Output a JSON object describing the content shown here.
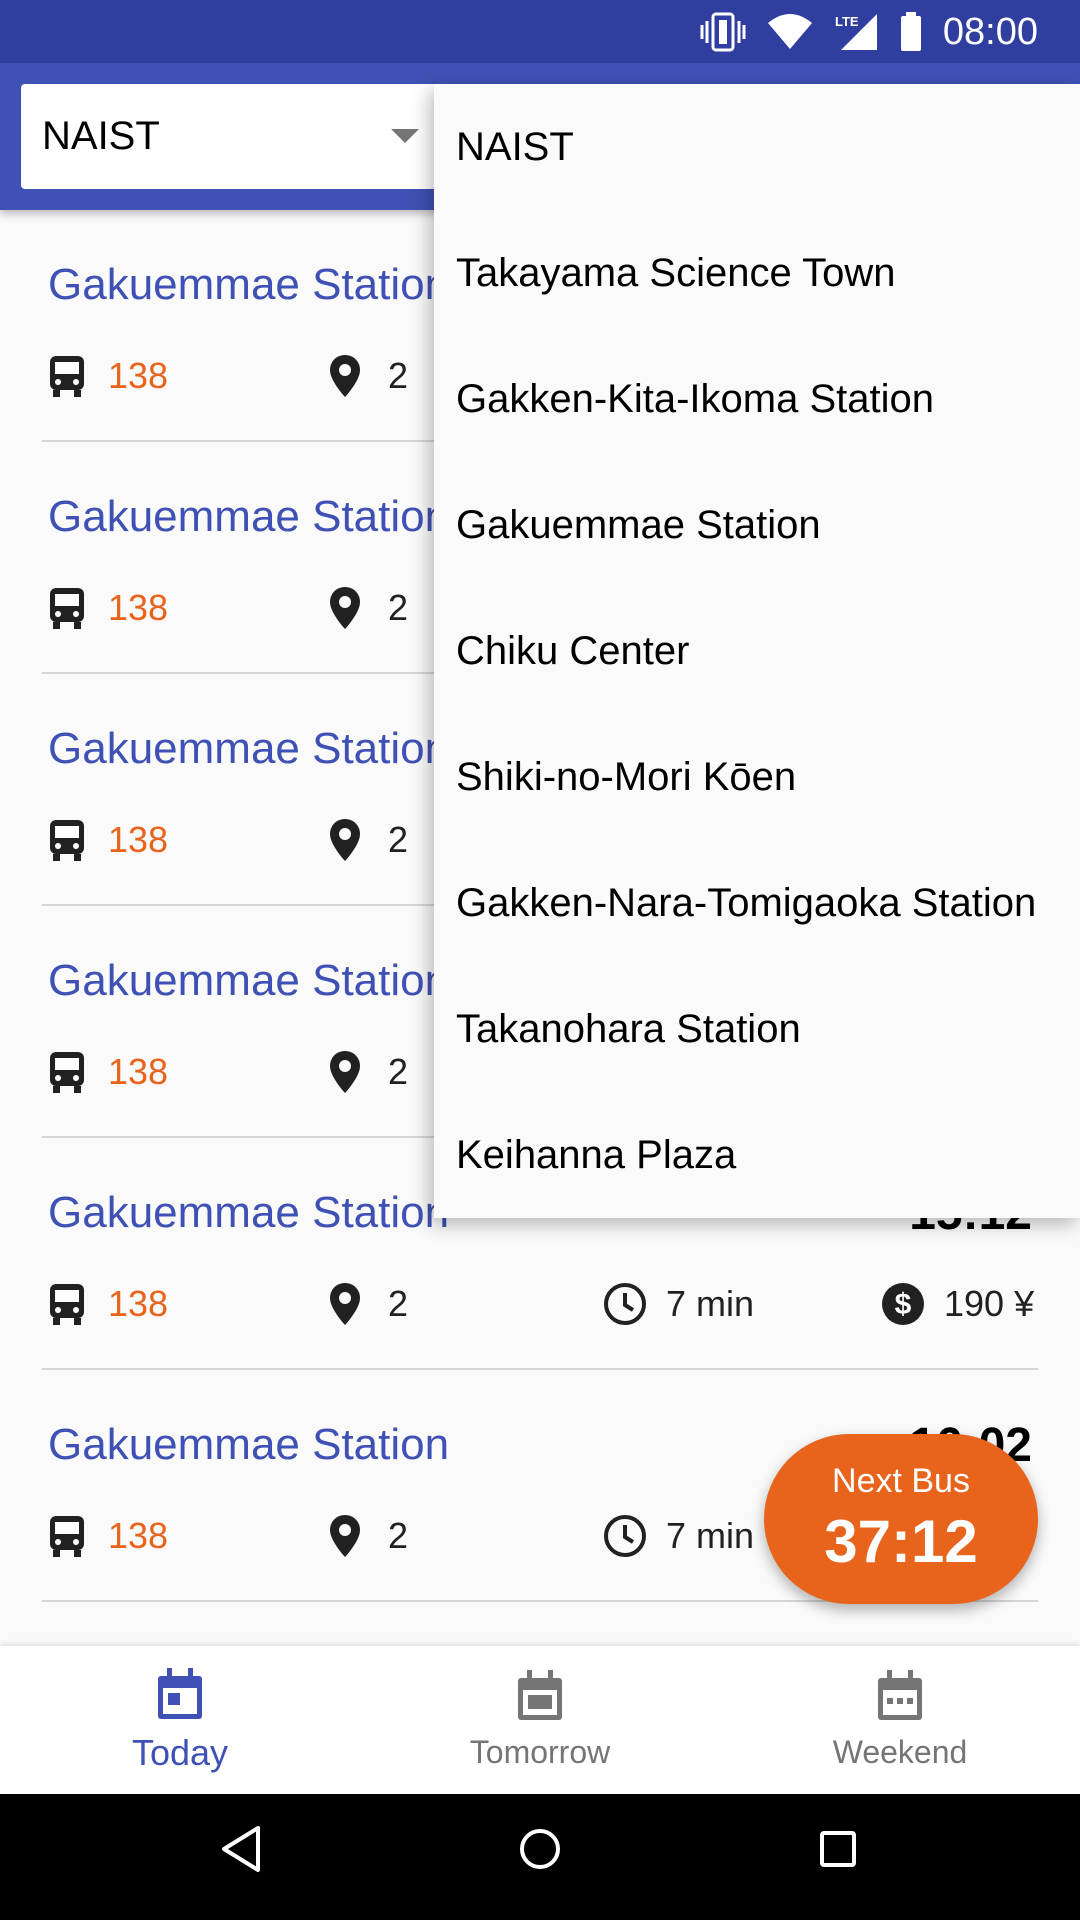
{
  "status_bar": {
    "time": "08:00",
    "network": "LTE"
  },
  "selector": {
    "value": "NAIST"
  },
  "dropdown": {
    "options": [
      "NAIST",
      "Takayama Science Town",
      "Gakken-Kita-Ikoma Station",
      "Gakuemmae Station",
      "Chiku Center",
      "Shiki-no-Mori Kōen",
      "Gakken-Nara-Tomigaoka Station",
      "Takanohara Station",
      "Keihanna Plaza"
    ]
  },
  "rows": [
    {
      "destination": "Gakuemmae Station",
      "bus": "138",
      "stop": "2"
    },
    {
      "destination": "Gakuemmae Station",
      "bus": "138",
      "stop": "2"
    },
    {
      "destination": "Gakuemmae Station",
      "bus": "138",
      "stop": "2"
    },
    {
      "destination": "Gakuemmae Station",
      "bus": "138",
      "stop": "2"
    },
    {
      "destination": "Gakuemmae Station",
      "time": "15:12",
      "bus": "138",
      "stop": "2",
      "duration": "7 min",
      "fare": "190 ¥"
    },
    {
      "destination": "Gakuemmae Station",
      "time": "16:02",
      "bus": "138",
      "stop": "2",
      "duration": "7 min"
    }
  ],
  "fab": {
    "label": "Next Bus",
    "countdown": "37:12"
  },
  "bottom_nav": {
    "items": [
      {
        "label": "Today",
        "icon": "calendar-today-icon",
        "active": true
      },
      {
        "label": "Tomorrow",
        "icon": "calendar-icon",
        "active": false
      },
      {
        "label": "Weekend",
        "icon": "calendar-dots-icon",
        "active": false
      }
    ]
  },
  "colors": {
    "primary": "#3f51b5",
    "primary_dark": "#303f9f",
    "accent": "#e8641c"
  }
}
